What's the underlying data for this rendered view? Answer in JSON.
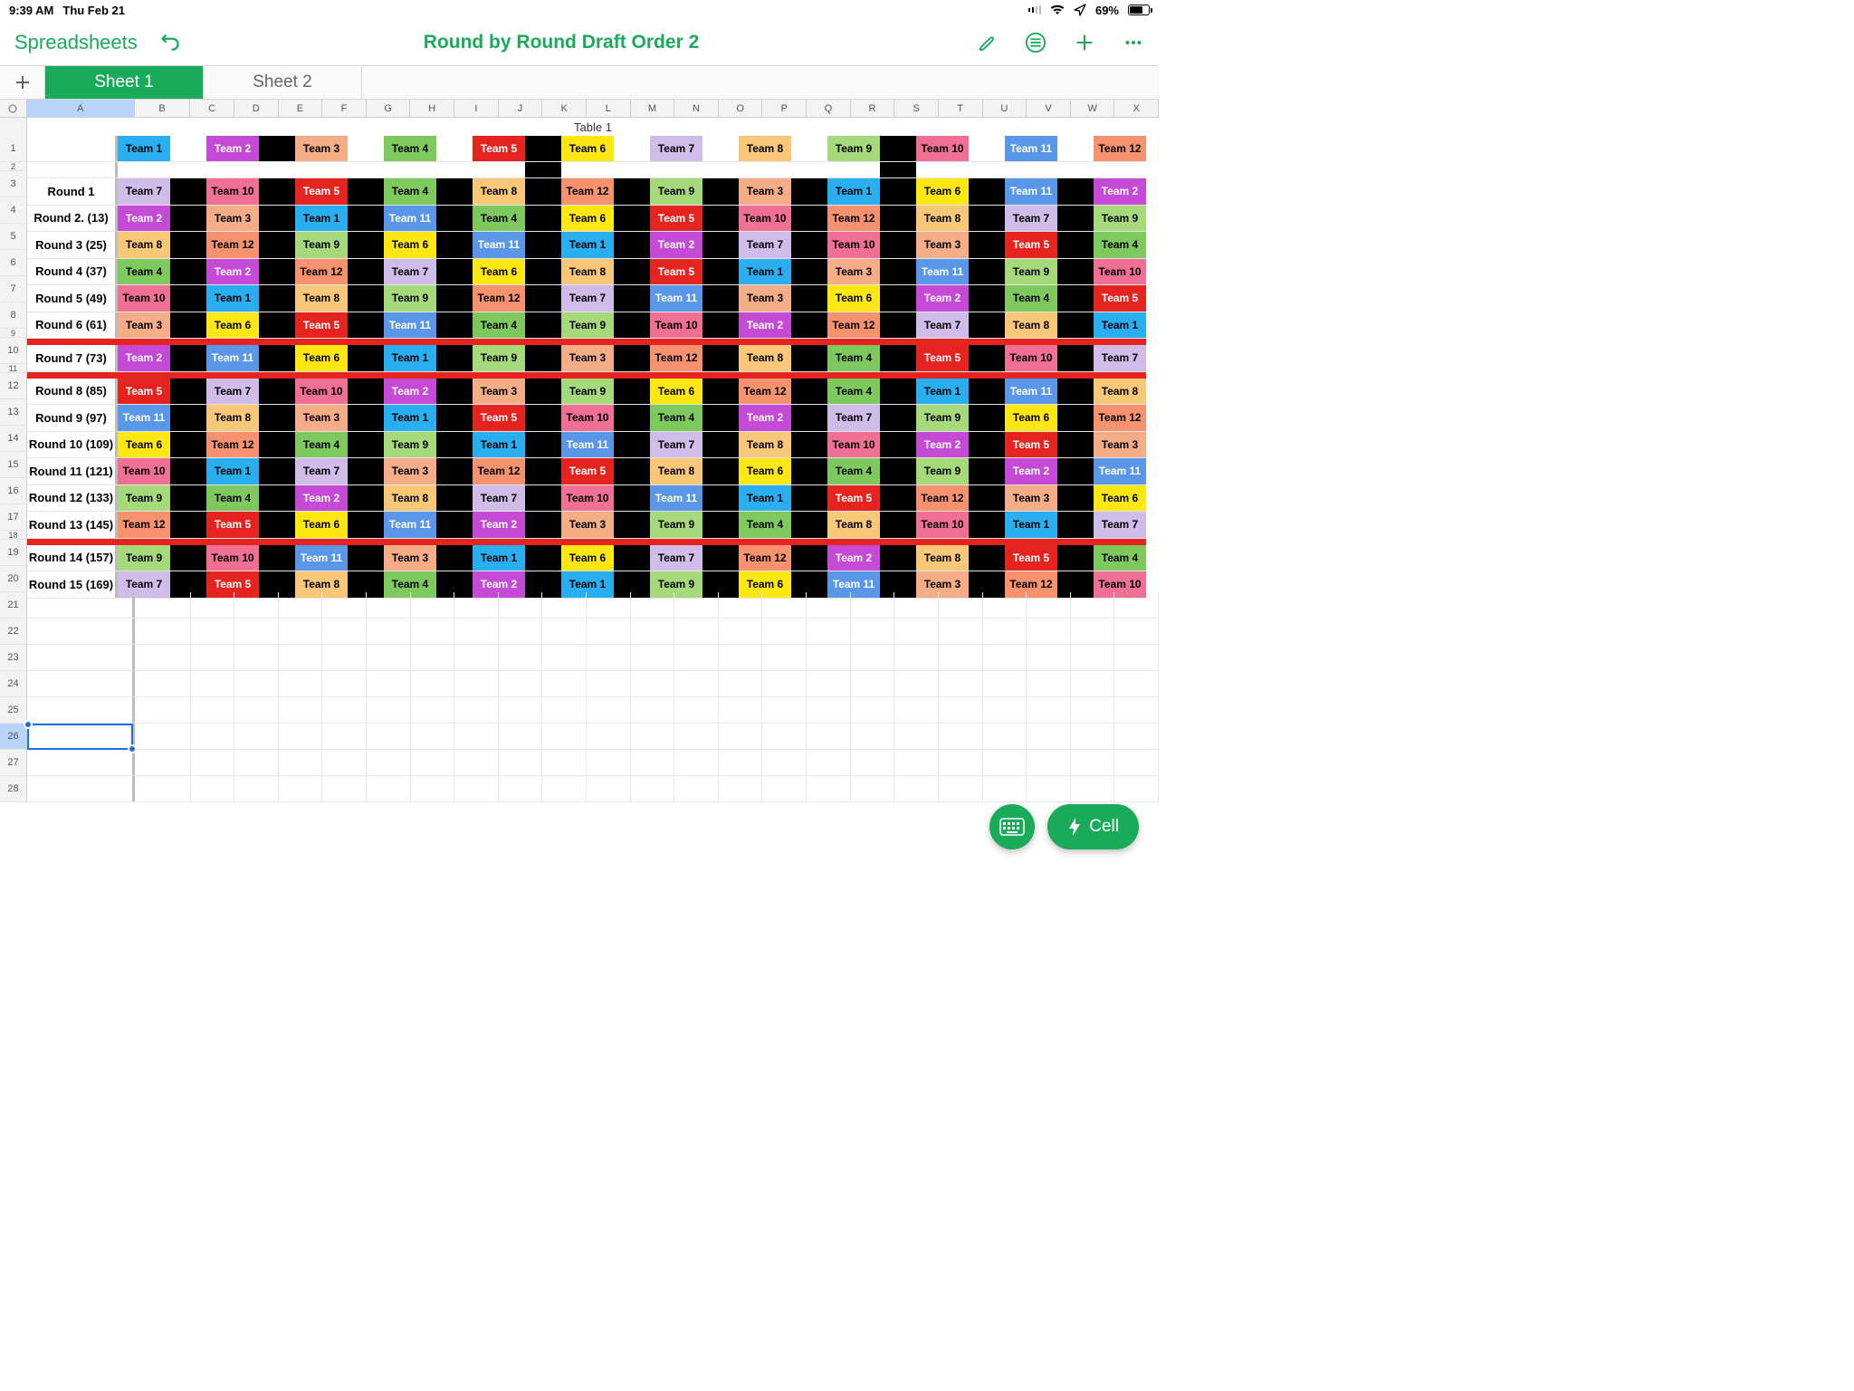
{
  "status": {
    "time": "9:39 AM",
    "date": "Thu Feb 21",
    "battery": "69%"
  },
  "toolbar": {
    "back": "Spreadsheets",
    "title": "Round by Round Draft Order 2"
  },
  "sheets": {
    "add_tab_plus": "+",
    "tabs": [
      "Sheet 1",
      "Sheet 2"
    ],
    "active": 0
  },
  "columns": [
    "A",
    "B",
    "C",
    "D",
    "E",
    "F",
    "G",
    "H",
    "I",
    "J",
    "K",
    "L",
    "M",
    "N",
    "O",
    "P",
    "Q",
    "R",
    "S",
    "T",
    "U",
    "V",
    "W",
    "X"
  ],
  "row_labels": [
    "1",
    "2",
    "3",
    "4",
    "5",
    "6",
    "7",
    "8",
    "9",
    "10",
    "11",
    "12",
    "13",
    "14",
    "15",
    "16",
    "17",
    "18",
    "19",
    "20",
    "21",
    "22",
    "23",
    "24",
    "25",
    "26",
    "27",
    "28"
  ],
  "table_title": "Table 1",
  "selected_cell": "A26",
  "teams": {
    "1": "Team 1",
    "2": "Team 2",
    "3": "Team 3",
    "4": "Team 4",
    "5": "Team 5",
    "6": "Team 6",
    "7": "Team 7",
    "8": "Team 8",
    "9": "Team 9",
    "10": "Team 10",
    "11": "Team 11",
    "12": "Team 12"
  },
  "header_order": [
    1,
    2,
    3,
    4,
    5,
    6,
    7,
    8,
    9,
    10,
    11,
    12
  ],
  "header_spacer_black": [
    2,
    5,
    9
  ],
  "rounds": [
    {
      "label": "Round 1",
      "picks": [
        7,
        10,
        5,
        4,
        8,
        12,
        9,
        3,
        1,
        6,
        11,
        2
      ]
    },
    {
      "label": "Round 2. (13)",
      "picks": [
        2,
        3,
        1,
        11,
        4,
        6,
        5,
        10,
        12,
        8,
        7,
        9
      ]
    },
    {
      "label": "Round 3 (25)",
      "picks": [
        8,
        12,
        9,
        6,
        11,
        1,
        2,
        7,
        10,
        3,
        5,
        4
      ]
    },
    {
      "label": "Round 4 (37)",
      "picks": [
        4,
        2,
        12,
        7,
        6,
        8,
        5,
        1,
        3,
        11,
        9,
        10
      ]
    },
    {
      "label": "Round 5 (49)",
      "picks": [
        10,
        1,
        8,
        9,
        12,
        7,
        11,
        3,
        6,
        2,
        4,
        5
      ]
    },
    {
      "label": "Round 6 (61)",
      "picks": [
        3,
        6,
        5,
        11,
        4,
        9,
        10,
        2,
        12,
        7,
        8,
        1
      ]
    },
    {
      "label": "Round 7 (73)",
      "picks": [
        2,
        11,
        6,
        1,
        9,
        3,
        12,
        8,
        4,
        5,
        10,
        7
      ]
    },
    {
      "label": "Round 8 (85)",
      "picks": [
        5,
        7,
        10,
        2,
        3,
        9,
        6,
        12,
        4,
        1,
        11,
        8
      ]
    },
    {
      "label": "Round 9 (97)",
      "picks": [
        11,
        8,
        3,
        1,
        5,
        10,
        4,
        2,
        7,
        9,
        6,
        12
      ]
    },
    {
      "label": "Round 10 (109)",
      "picks": [
        6,
        12,
        4,
        9,
        1,
        11,
        7,
        8,
        10,
        2,
        5,
        3
      ]
    },
    {
      "label": "Round 11 (121)",
      "picks": [
        10,
        1,
        7,
        3,
        12,
        5,
        8,
        6,
        4,
        9,
        2,
        11
      ]
    },
    {
      "label": "Round 12 (133)",
      "picks": [
        9,
        4,
        2,
        8,
        7,
        10,
        11,
        1,
        5,
        12,
        3,
        6
      ]
    },
    {
      "label": "Round 13 (145)",
      "picks": [
        12,
        5,
        6,
        11,
        2,
        3,
        9,
        4,
        8,
        10,
        1,
        7
      ]
    },
    {
      "label": "Round 14 (157)",
      "picks": [
        9,
        10,
        11,
        3,
        1,
        6,
        7,
        12,
        2,
        8,
        5,
        4
      ]
    },
    {
      "label": "Round 15 (169)",
      "picks": [
        7,
        5,
        8,
        4,
        2,
        1,
        9,
        6,
        11,
        3,
        12,
        10
      ]
    }
  ],
  "red_bars_after_round_index": [
    5,
    6,
    12
  ],
  "fab": {
    "cell": "Cell"
  },
  "col_widths": {
    "A": 120,
    "B": 62,
    "rest": 49
  }
}
